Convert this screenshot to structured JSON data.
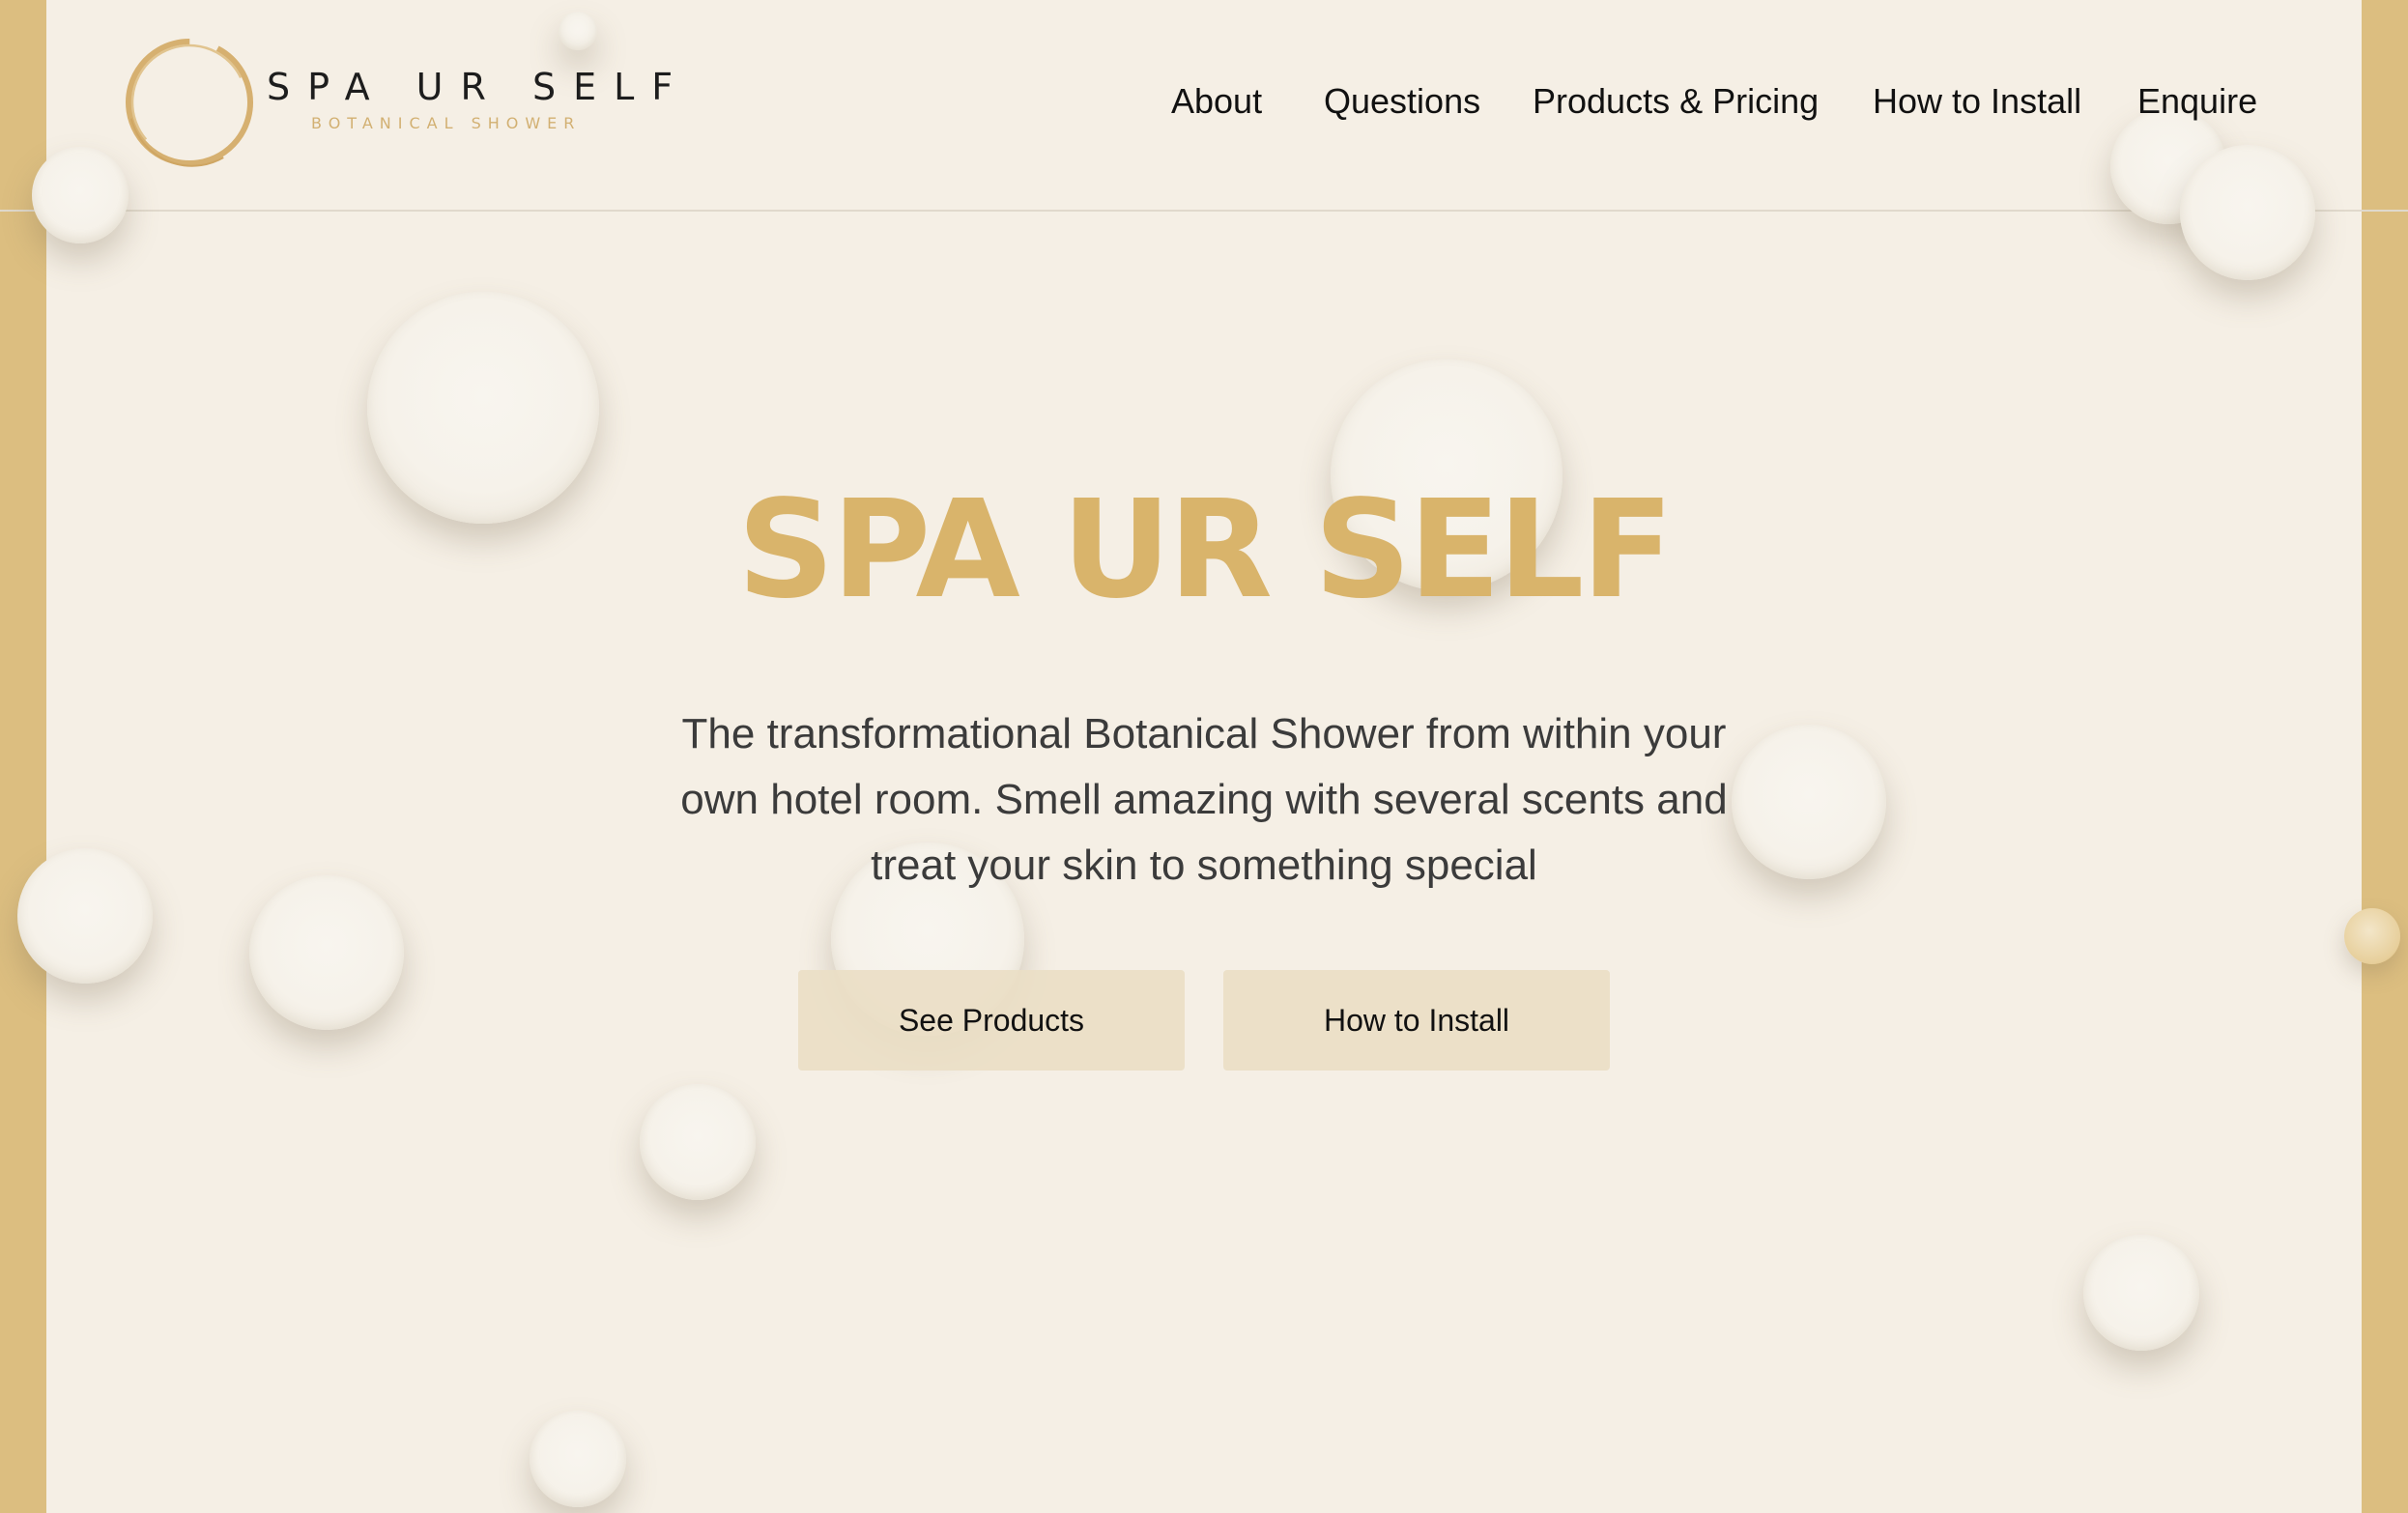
{
  "brand": {
    "name": "SPA UR SELF",
    "tagline": "BOTANICAL SHOWER"
  },
  "nav": {
    "items": [
      {
        "label": "About"
      },
      {
        "label": "Questions"
      },
      {
        "label": "Products & Pricing"
      },
      {
        "label": "How to Install"
      },
      {
        "label": "Enquire"
      }
    ]
  },
  "hero": {
    "title": "SPA UR SELF",
    "description": "The transformational Botanical Shower from within your own hotel room. Smell amazing with several scents and treat your skin to something special",
    "primary_button": "See Products",
    "secondary_button": "How to Install"
  },
  "colors": {
    "gold_accent": "#d9b46b",
    "side_bar": "#dcbe80",
    "background": "#f5efe5",
    "button_bg": "#ecdfc8"
  }
}
